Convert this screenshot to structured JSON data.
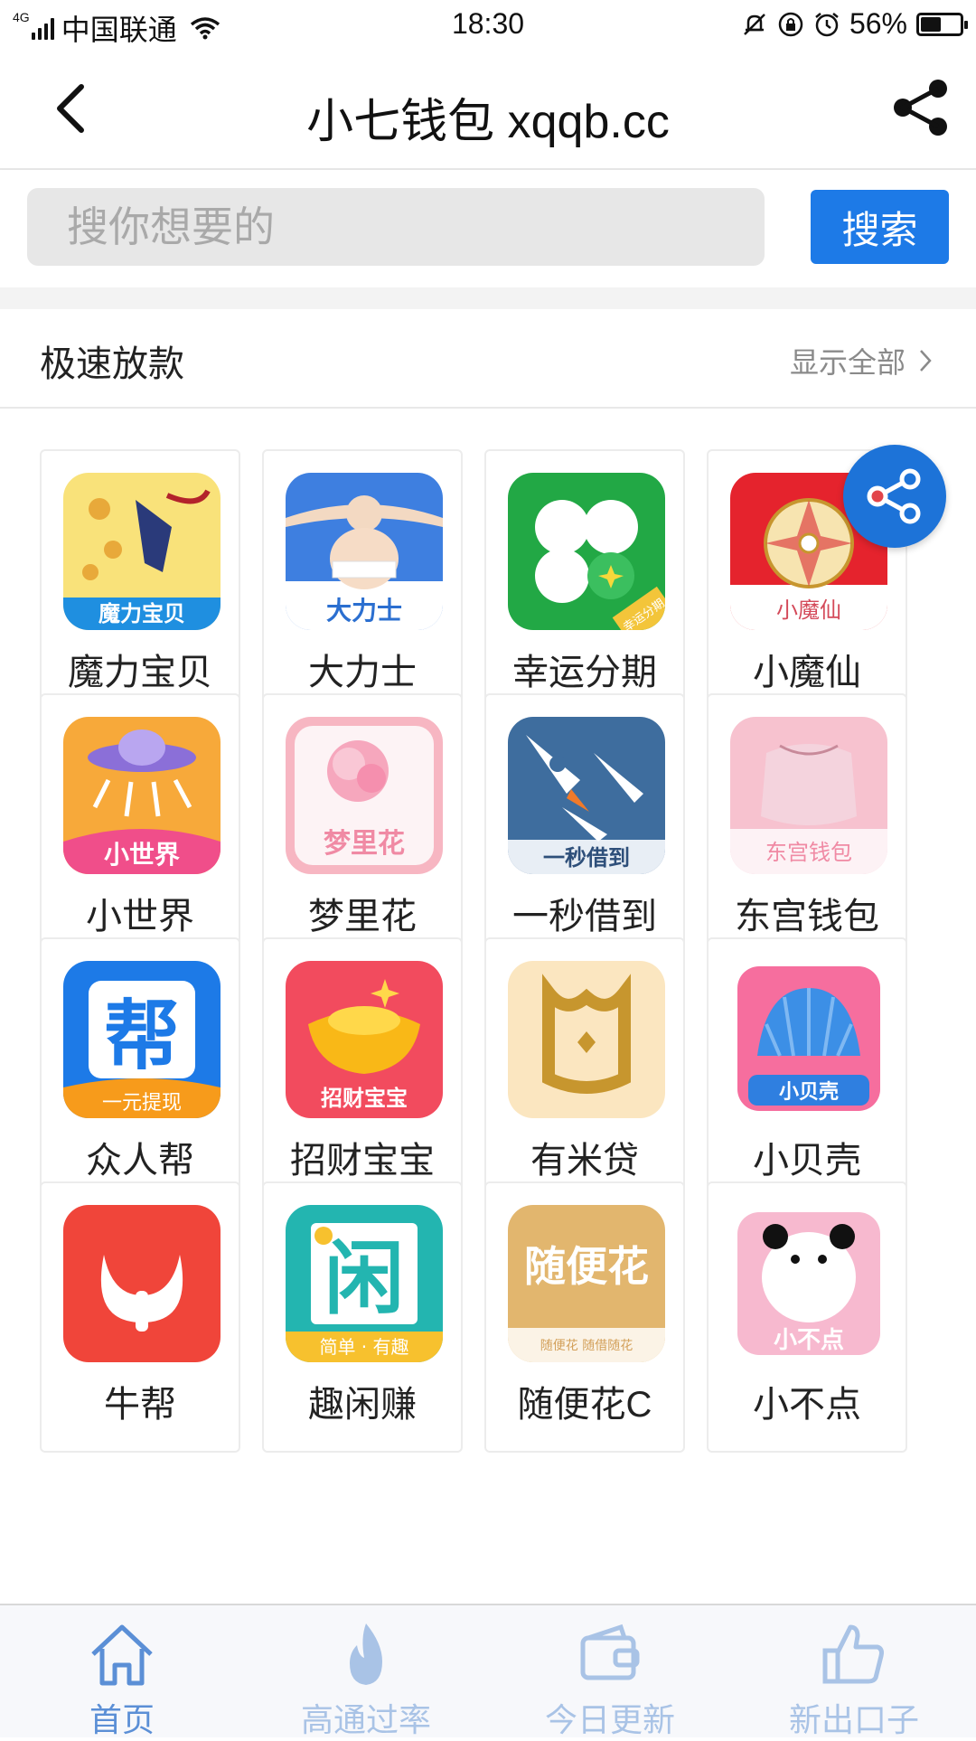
{
  "status_bar": {
    "network": "4G",
    "carrier": "中国联通",
    "time": "18:30",
    "battery_percent": "56%",
    "battery_level": 0.56
  },
  "header": {
    "title": "小七钱包 xqqb.cc"
  },
  "search": {
    "placeholder": "搜你想要的",
    "button_label": "搜索"
  },
  "section": {
    "title": "极速放款",
    "show_all_label": "显示全部"
  },
  "apps": [
    {
      "name": "魔力宝贝",
      "icon_label": "魔力宝贝"
    },
    {
      "name": "大力士",
      "icon_label": "大力士"
    },
    {
      "name": "幸运分期",
      "icon_label": "幸运分期"
    },
    {
      "name": "小魔仙",
      "icon_label": "小魔仙"
    },
    {
      "name": "小世界",
      "icon_label": "小世界"
    },
    {
      "name": "梦里花",
      "icon_label": "梦里花"
    },
    {
      "name": "一秒借到",
      "icon_label": "一秒借到"
    },
    {
      "name": "东宫钱包",
      "icon_label": "东宫钱包"
    },
    {
      "name": "众人帮",
      "icon_label": "一元提现",
      "icon_text": "帮"
    },
    {
      "name": "招财宝宝",
      "icon_label": "招财宝宝"
    },
    {
      "name": "有米贷",
      "icon_label": ""
    },
    {
      "name": "小贝壳",
      "icon_label": "小贝壳"
    },
    {
      "name": "牛帮",
      "icon_label": ""
    },
    {
      "name": "趣闲赚",
      "icon_label": "简单 · 有趣",
      "icon_text": "闲"
    },
    {
      "name": "随便花C",
      "icon_label": "随便花  随借随花",
      "icon_text": "随便花"
    },
    {
      "name": "小不点",
      "icon_label": "小不点"
    }
  ],
  "bottom_nav": [
    {
      "label": "首页",
      "icon": "home-icon",
      "active": true
    },
    {
      "label": "高通过率",
      "icon": "flame-icon",
      "active": false
    },
    {
      "label": "今日更新",
      "icon": "wallet-icon",
      "active": false
    },
    {
      "label": "新出口子",
      "icon": "thumbs-up-icon",
      "active": false
    }
  ],
  "colors": {
    "accent_blue": "#1d7ae7",
    "nav_active": "#5b8fd6",
    "nav_inactive": "#a9c3e6"
  }
}
